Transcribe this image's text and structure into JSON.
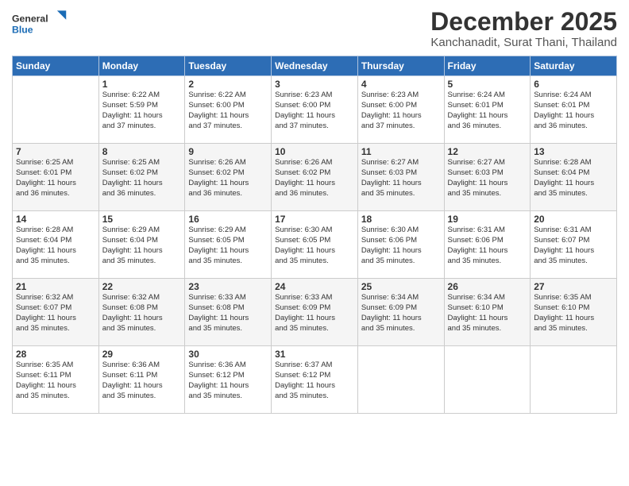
{
  "logo": {
    "line1": "General",
    "line2": "Blue"
  },
  "title": "December 2025",
  "subtitle": "Kanchanadit, Surat Thani, Thailand",
  "days_of_week": [
    "Sunday",
    "Monday",
    "Tuesday",
    "Wednesday",
    "Thursday",
    "Friday",
    "Saturday"
  ],
  "weeks": [
    [
      {
        "day": "",
        "info": ""
      },
      {
        "day": "1",
        "info": "Sunrise: 6:22 AM\nSunset: 5:59 PM\nDaylight: 11 hours\nand 37 minutes."
      },
      {
        "day": "2",
        "info": "Sunrise: 6:22 AM\nSunset: 6:00 PM\nDaylight: 11 hours\nand 37 minutes."
      },
      {
        "day": "3",
        "info": "Sunrise: 6:23 AM\nSunset: 6:00 PM\nDaylight: 11 hours\nand 37 minutes."
      },
      {
        "day": "4",
        "info": "Sunrise: 6:23 AM\nSunset: 6:00 PM\nDaylight: 11 hours\nand 37 minutes."
      },
      {
        "day": "5",
        "info": "Sunrise: 6:24 AM\nSunset: 6:01 PM\nDaylight: 11 hours\nand 36 minutes."
      },
      {
        "day": "6",
        "info": "Sunrise: 6:24 AM\nSunset: 6:01 PM\nDaylight: 11 hours\nand 36 minutes."
      }
    ],
    [
      {
        "day": "7",
        "info": "Sunrise: 6:25 AM\nSunset: 6:01 PM\nDaylight: 11 hours\nand 36 minutes."
      },
      {
        "day": "8",
        "info": "Sunrise: 6:25 AM\nSunset: 6:02 PM\nDaylight: 11 hours\nand 36 minutes."
      },
      {
        "day": "9",
        "info": "Sunrise: 6:26 AM\nSunset: 6:02 PM\nDaylight: 11 hours\nand 36 minutes."
      },
      {
        "day": "10",
        "info": "Sunrise: 6:26 AM\nSunset: 6:02 PM\nDaylight: 11 hours\nand 36 minutes."
      },
      {
        "day": "11",
        "info": "Sunrise: 6:27 AM\nSunset: 6:03 PM\nDaylight: 11 hours\nand 35 minutes."
      },
      {
        "day": "12",
        "info": "Sunrise: 6:27 AM\nSunset: 6:03 PM\nDaylight: 11 hours\nand 35 minutes."
      },
      {
        "day": "13",
        "info": "Sunrise: 6:28 AM\nSunset: 6:04 PM\nDaylight: 11 hours\nand 35 minutes."
      }
    ],
    [
      {
        "day": "14",
        "info": "Sunrise: 6:28 AM\nSunset: 6:04 PM\nDaylight: 11 hours\nand 35 minutes."
      },
      {
        "day": "15",
        "info": "Sunrise: 6:29 AM\nSunset: 6:04 PM\nDaylight: 11 hours\nand 35 minutes."
      },
      {
        "day": "16",
        "info": "Sunrise: 6:29 AM\nSunset: 6:05 PM\nDaylight: 11 hours\nand 35 minutes."
      },
      {
        "day": "17",
        "info": "Sunrise: 6:30 AM\nSunset: 6:05 PM\nDaylight: 11 hours\nand 35 minutes."
      },
      {
        "day": "18",
        "info": "Sunrise: 6:30 AM\nSunset: 6:06 PM\nDaylight: 11 hours\nand 35 minutes."
      },
      {
        "day": "19",
        "info": "Sunrise: 6:31 AM\nSunset: 6:06 PM\nDaylight: 11 hours\nand 35 minutes."
      },
      {
        "day": "20",
        "info": "Sunrise: 6:31 AM\nSunset: 6:07 PM\nDaylight: 11 hours\nand 35 minutes."
      }
    ],
    [
      {
        "day": "21",
        "info": "Sunrise: 6:32 AM\nSunset: 6:07 PM\nDaylight: 11 hours\nand 35 minutes."
      },
      {
        "day": "22",
        "info": "Sunrise: 6:32 AM\nSunset: 6:08 PM\nDaylight: 11 hours\nand 35 minutes."
      },
      {
        "day": "23",
        "info": "Sunrise: 6:33 AM\nSunset: 6:08 PM\nDaylight: 11 hours\nand 35 minutes."
      },
      {
        "day": "24",
        "info": "Sunrise: 6:33 AM\nSunset: 6:09 PM\nDaylight: 11 hours\nand 35 minutes."
      },
      {
        "day": "25",
        "info": "Sunrise: 6:34 AM\nSunset: 6:09 PM\nDaylight: 11 hours\nand 35 minutes."
      },
      {
        "day": "26",
        "info": "Sunrise: 6:34 AM\nSunset: 6:10 PM\nDaylight: 11 hours\nand 35 minutes."
      },
      {
        "day": "27",
        "info": "Sunrise: 6:35 AM\nSunset: 6:10 PM\nDaylight: 11 hours\nand 35 minutes."
      }
    ],
    [
      {
        "day": "28",
        "info": "Sunrise: 6:35 AM\nSunset: 6:11 PM\nDaylight: 11 hours\nand 35 minutes."
      },
      {
        "day": "29",
        "info": "Sunrise: 6:36 AM\nSunset: 6:11 PM\nDaylight: 11 hours\nand 35 minutes."
      },
      {
        "day": "30",
        "info": "Sunrise: 6:36 AM\nSunset: 6:12 PM\nDaylight: 11 hours\nand 35 minutes."
      },
      {
        "day": "31",
        "info": "Sunrise: 6:37 AM\nSunset: 6:12 PM\nDaylight: 11 hours\nand 35 minutes."
      },
      {
        "day": "",
        "info": ""
      },
      {
        "day": "",
        "info": ""
      },
      {
        "day": "",
        "info": ""
      }
    ]
  ]
}
